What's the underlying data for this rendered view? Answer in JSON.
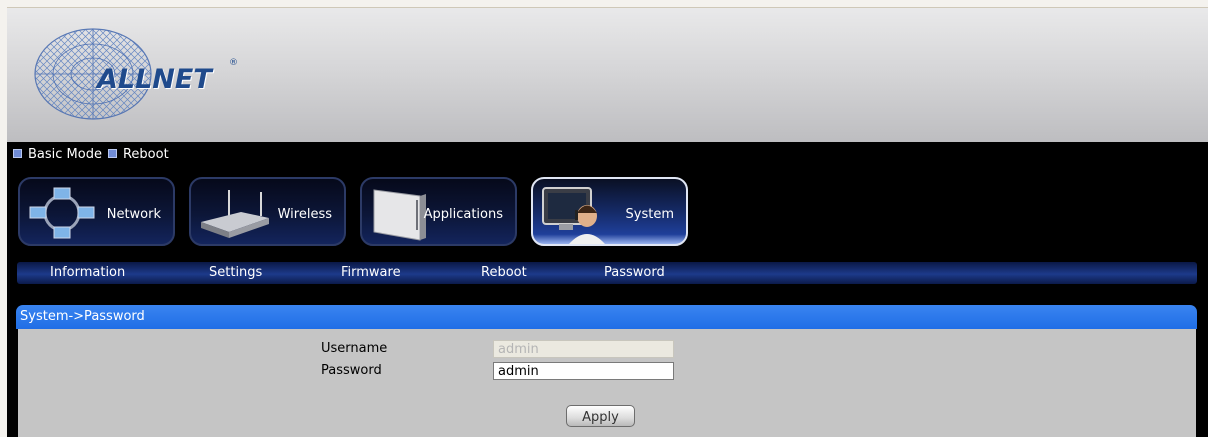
{
  "brand": {
    "name": "ALLNET",
    "registered": "®"
  },
  "quick_links": [
    {
      "label": "Basic Mode"
    },
    {
      "label": "Reboot"
    }
  ],
  "main_nav": [
    {
      "label": "Network",
      "icon": "network-icon",
      "active": false
    },
    {
      "label": "Wireless",
      "icon": "router-icon",
      "active": false
    },
    {
      "label": "Applications",
      "icon": "applications-icon",
      "active": false
    },
    {
      "label": "System",
      "icon": "system-user-icon",
      "active": true
    }
  ],
  "sub_nav": [
    {
      "label": "Information"
    },
    {
      "label": "Settings"
    },
    {
      "label": "Firmware"
    },
    {
      "label": "Reboot"
    },
    {
      "label": "Password"
    }
  ],
  "panel": {
    "title": "System->Password",
    "username_label": "Username",
    "username_value": "admin",
    "password_label": "Password",
    "password_value": "admin",
    "apply_label": "Apply"
  },
  "colors": {
    "panel_header": "#2a78ea",
    "panel_body": "#c5c5c5",
    "brand": "#1f4a8c"
  }
}
